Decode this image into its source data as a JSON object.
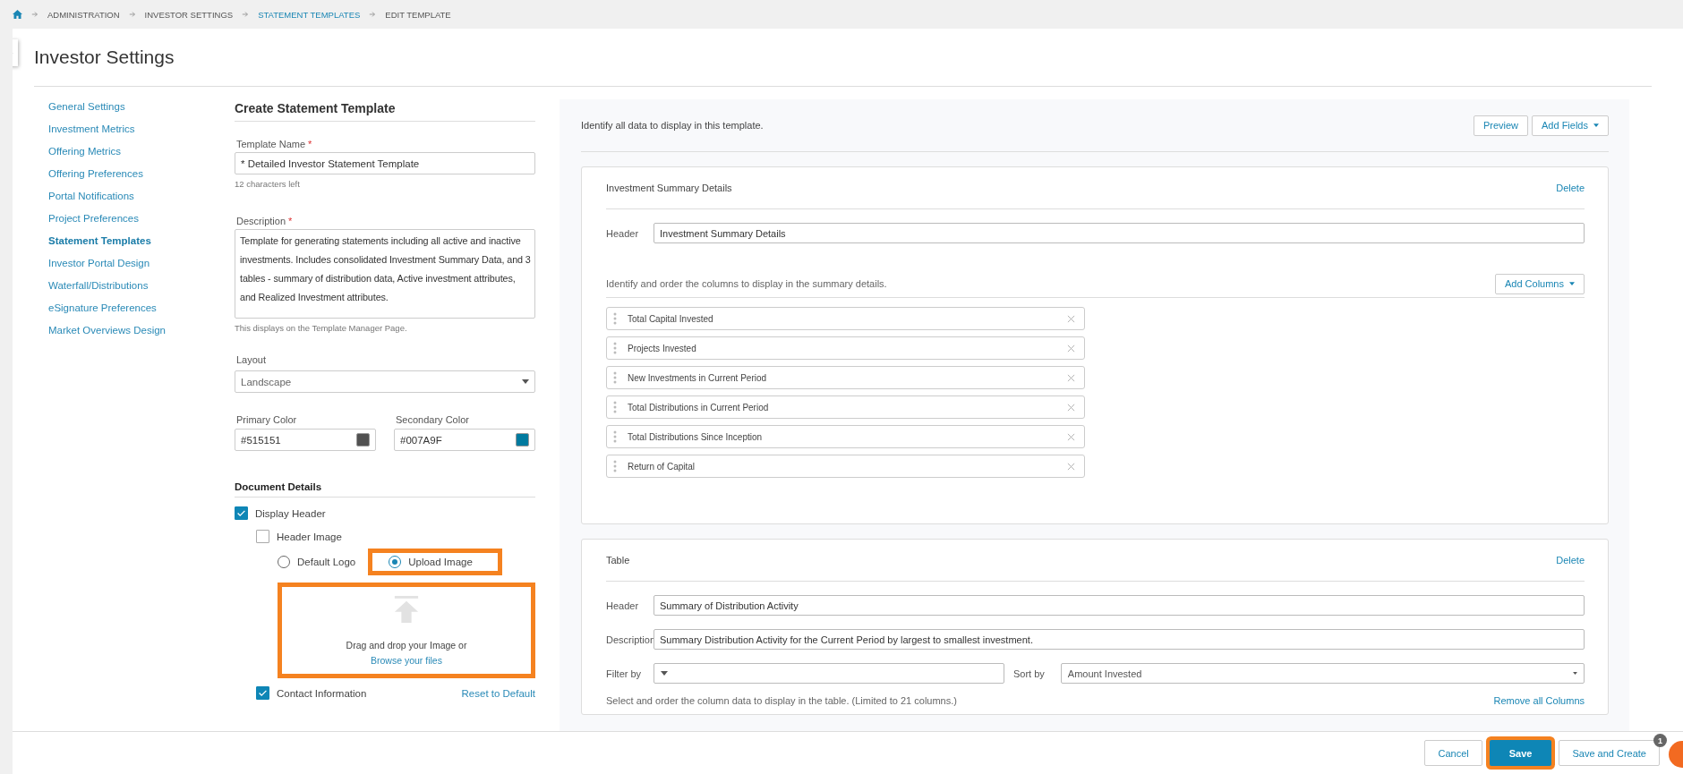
{
  "breadcrumb": [
    {
      "label": "ADMINISTRATION",
      "link": false
    },
    {
      "label": "INVESTOR SETTINGS",
      "link": false
    },
    {
      "label": "STATEMENT TEMPLATES",
      "link": true
    },
    {
      "label": "EDIT TEMPLATE",
      "link": false
    }
  ],
  "page_title": "Investor Settings",
  "sidebar": {
    "items": [
      {
        "label": "General Settings",
        "selected": false
      },
      {
        "label": "Investment Metrics",
        "selected": false
      },
      {
        "label": "Offering Metrics",
        "selected": false
      },
      {
        "label": "Offering Preferences",
        "selected": false
      },
      {
        "label": "Portal Notifications",
        "selected": false
      },
      {
        "label": "Project Preferences",
        "selected": false
      },
      {
        "label": "Statement Templates",
        "selected": true
      },
      {
        "label": "Investor Portal Design",
        "selected": false
      },
      {
        "label": "Waterfall/Distributions",
        "selected": false
      },
      {
        "label": "eSignature Preferences",
        "selected": false
      },
      {
        "label": "Market Overviews Design",
        "selected": false
      }
    ]
  },
  "form": {
    "title": "Create Statement Template",
    "template_name": {
      "label": "Template Name",
      "required_mark": "*",
      "value": "* Detailed Investor Statement Template",
      "hint": "12 characters left"
    },
    "description": {
      "label": "Description",
      "required_mark": "*",
      "value": "Template for generating statements including all active and inactive investments. Includes consolidated Investment Summary Data, and 3 tables - summary of distribution data, Active investment attributes, and Realized Investment attributes.",
      "hint": "This displays on the Template Manager Page."
    },
    "layout": {
      "label": "Layout",
      "value": "Landscape"
    },
    "colors": [
      {
        "label": "Primary Color",
        "value": "#515151",
        "color": "#515151"
      },
      {
        "label": "Secondary Color",
        "value": "#007A9F",
        "color": "#007a9f"
      }
    ],
    "document_details": {
      "title": "Document Details",
      "display_header": {
        "label": "Display Header",
        "checked": true
      },
      "header_image": {
        "label": "Header Image",
        "checked": false
      },
      "logo_options": [
        {
          "label": "Default Logo",
          "selected": false,
          "highlighted": false
        },
        {
          "label": "Upload Image",
          "selected": true,
          "highlighted": true
        }
      ],
      "upload": {
        "text": "Drag and drop your Image or",
        "link": "Browse your files",
        "highlighted": true
      },
      "contact_information": {
        "label": "Contact Information",
        "checked": true
      },
      "reset_link": "Reset to Default"
    }
  },
  "fields_panel": {
    "intro": "Identify all data to display in this template.",
    "buttons": [
      "Preview",
      "Add Fields"
    ],
    "summary_section": {
      "title": "Investment Summary Details",
      "delete": "Delete",
      "header_label": "Header",
      "header_value": "Investment Summary Details",
      "columns_intro": "Identify and order the columns to display in the summary details.",
      "add_columns": "Add Columns",
      "columns": [
        "Total Capital Invested",
        "Projects Invested",
        "New Investments in Current Period",
        "Total Distributions in Current Period",
        "Total Distributions Since Inception",
        "Return of Capital"
      ]
    },
    "table_section": {
      "title": "Table",
      "delete": "Delete",
      "header_label": "Header",
      "header_value": "Summary of Distribution Activity",
      "description_label": "Description",
      "description_value": "Summary Distribution Activity for the Current Period by largest to smallest investment.",
      "filter_label": "Filter by",
      "sort_label": "Sort by",
      "sort_value": "Amount Invested",
      "columns_intro": "Select and order the column data to display in the table. (Limited to 21 columns.)",
      "remove_all": "Remove all Columns"
    }
  },
  "footer": {
    "buttons": [
      {
        "label": "Cancel",
        "kind": "secondary",
        "highlighted": false
      },
      {
        "label": "Save",
        "kind": "primary",
        "highlighted": true
      },
      {
        "label": "Save and Create",
        "kind": "secondary",
        "highlighted": false
      }
    ],
    "help_badge": "1"
  }
}
